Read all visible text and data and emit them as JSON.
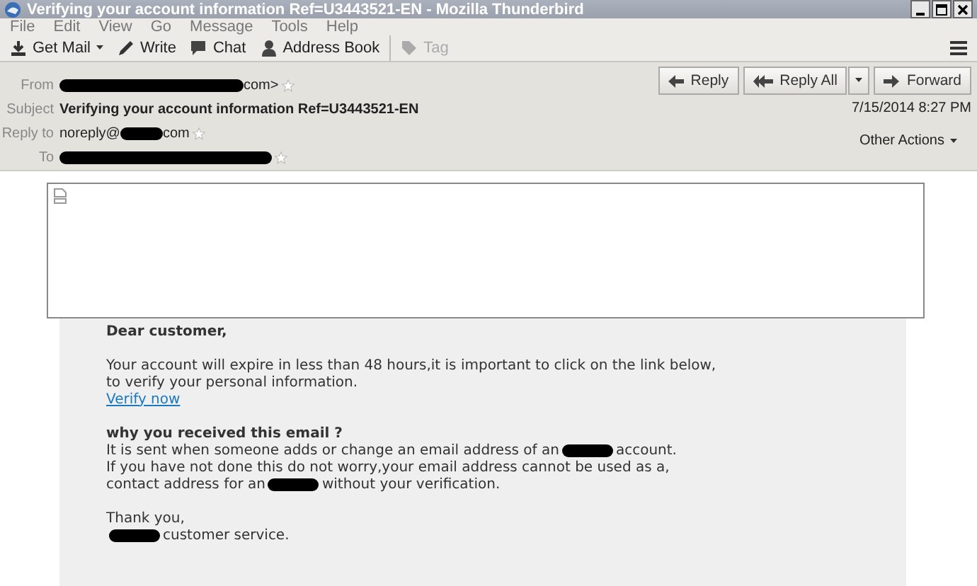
{
  "window": {
    "title": "Verifying your account information Ref=U3443521-EN - Mozilla Thunderbird"
  },
  "menu": [
    "File",
    "Edit",
    "View",
    "Go",
    "Message",
    "Tools",
    "Help"
  ],
  "toolbar": [
    {
      "kind": "getmail",
      "label": "Get Mail",
      "disabled": false
    },
    {
      "kind": "write",
      "label": "Write",
      "disabled": false
    },
    {
      "kind": "chat",
      "label": "Chat",
      "disabled": false
    },
    {
      "kind": "addressbook",
      "label": "Address Book",
      "disabled": false
    },
    {
      "kind": "tag",
      "label": "Tag",
      "disabled": true
    }
  ],
  "header": {
    "fields": [
      {
        "label": "From",
        "star": true,
        "parts": [
          {
            "kind": "redacted"
          },
          {
            "kind": "text",
            "text": "com>"
          }
        ]
      },
      {
        "label": "Subject",
        "star": false,
        "parts": [
          {
            "kind": "bold",
            "text": "Verifying your account information Ref=U3443521-EN"
          }
        ]
      },
      {
        "label": "Reply to",
        "star": true,
        "parts": [
          {
            "kind": "text",
            "text": "noreply@"
          },
          {
            "kind": "redacted"
          },
          {
            "kind": "text",
            "text": "com"
          }
        ]
      },
      {
        "label": "To",
        "star": true,
        "parts": [
          {
            "kind": "redacted"
          }
        ]
      }
    ],
    "actions": [
      {
        "kind": "reply",
        "label": "Reply"
      },
      {
        "kind": "replyall",
        "label": "Reply All"
      },
      {
        "kind": "forward",
        "label": "Forward"
      }
    ],
    "date": "7/15/2014 8:27 PM",
    "other_actions": "Other Actions"
  },
  "body": {
    "paragraphs": [
      [
        {
          "kind": "bold",
          "parts": [
            {
              "kind": "text",
              "text": "Dear customer,"
            }
          ]
        }
      ],
      [
        {
          "kind": "text",
          "parts": [
            {
              "kind": "text",
              "text": "Your account will expire in less than 48 hours,it is important to click on the link below,"
            }
          ]
        },
        {
          "kind": "text",
          "parts": [
            {
              "kind": "text",
              "text": "to verify your personal information."
            }
          ]
        },
        {
          "kind": "link",
          "parts": [
            {
              "kind": "text",
              "text": "Verify now"
            }
          ]
        }
      ],
      [
        {
          "kind": "bold",
          "parts": [
            {
              "kind": "text",
              "text": "why you received this email ?"
            }
          ]
        },
        {
          "kind": "text",
          "parts": [
            {
              "kind": "text",
              "text": "It is sent when someone adds or change an email address of an"
            },
            {
              "kind": "redacted"
            },
            {
              "kind": "text",
              "text": "account."
            }
          ]
        },
        {
          "kind": "text",
          "parts": [
            {
              "kind": "text",
              "text": "If you have not done this do not worry,your email address cannot be used as a,"
            }
          ]
        },
        {
          "kind": "text",
          "parts": [
            {
              "kind": "text",
              "text": "contact address for an"
            },
            {
              "kind": "redacted"
            },
            {
              "kind": "text",
              "text": "without your verification."
            }
          ]
        }
      ],
      [
        {
          "kind": "text",
          "parts": [
            {
              "kind": "text",
              "text": "Thank you,"
            }
          ]
        },
        {
          "kind": "text",
          "parts": [
            {
              "kind": "redacted"
            },
            {
              "kind": "text",
              "text": "customer service."
            }
          ]
        }
      ]
    ]
  }
}
